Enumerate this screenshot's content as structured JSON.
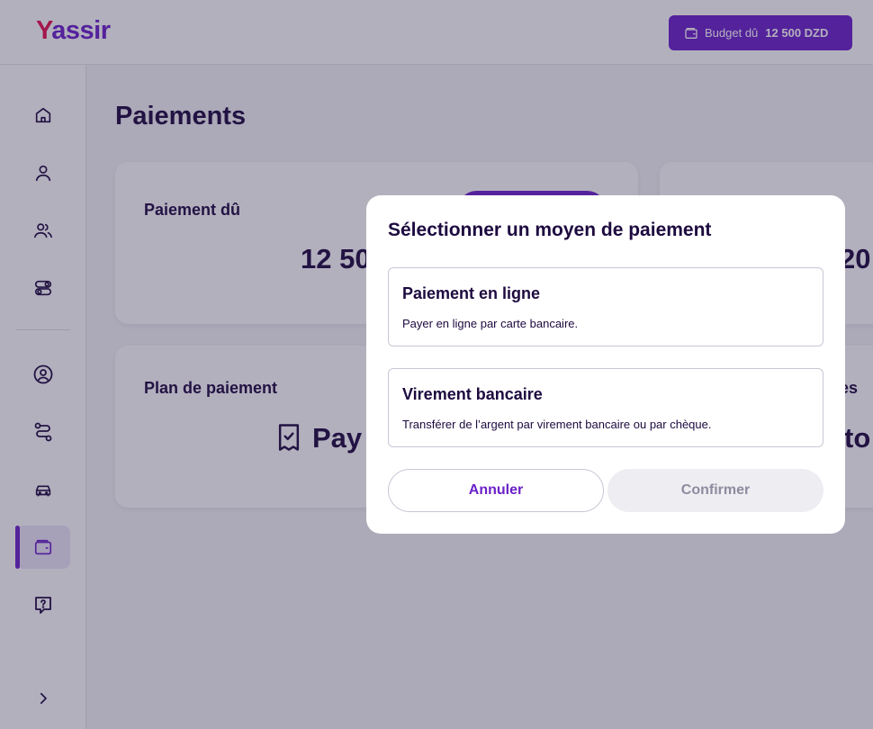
{
  "header": {
    "logo_first": "Y",
    "logo_rest": "assir",
    "budget_label": "Budget dû",
    "budget_amount": "12 500 DZD"
  },
  "sidebar": {
    "items": [
      {
        "name": "home",
        "icon": "home-icon"
      },
      {
        "name": "profile",
        "icon": "user-icon"
      },
      {
        "name": "team",
        "icon": "users-icon"
      },
      {
        "name": "settings",
        "icon": "toggles-icon"
      },
      {
        "name": "account",
        "icon": "user-circle-icon"
      },
      {
        "name": "routes",
        "icon": "route-icon"
      },
      {
        "name": "vehicles",
        "icon": "car-icon"
      },
      {
        "name": "payments",
        "icon": "wallet-icon",
        "active": true
      },
      {
        "name": "help",
        "icon": "help-icon"
      },
      {
        "name": "expand",
        "icon": "chevron-right-icon"
      }
    ]
  },
  "main": {
    "title": "Paiements",
    "cards": [
      {
        "label": "Paiement dû",
        "value": "12 50"
      },
      {
        "label": "",
        "value": "20"
      },
      {
        "label": "Plan de paiement",
        "value": "Pay"
      },
      {
        "label": "es",
        "value": "to"
      }
    ]
  },
  "modal": {
    "title": "Sélectionner un moyen de paiement",
    "options": [
      {
        "title": "Paiement en ligne",
        "description": "Payer en ligne par carte bancaire."
      },
      {
        "title": "Virement bancaire",
        "description": "Transférer de l’argent par virement bancaire ou par chèque."
      }
    ],
    "cancel_label": "Annuler",
    "confirm_label": "Confirmer"
  },
  "colors": {
    "accent": "#6b21c8",
    "logo_red": "#e5124d",
    "text_dark": "#1d0a3f"
  }
}
